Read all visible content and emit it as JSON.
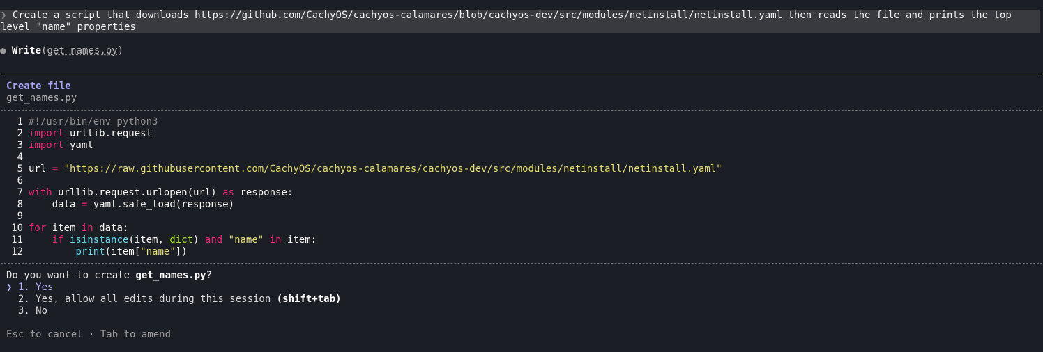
{
  "prompt": {
    "chevron": "❯",
    "text": "Create a script that downloads https://github.com/CachyOS/cachyos-calamares/blob/cachyos-dev/src/modules/netinstall/netinstall.yaml then reads the file and prints the top level \"name\" properties"
  },
  "tool_call": {
    "bullet": "●",
    "name": "Write",
    "open_paren": "(",
    "path": "get_names.py",
    "close_paren": ")"
  },
  "create_panel": {
    "title": "Create file",
    "filename": "get_names.py"
  },
  "code": {
    "line_numbers": [
      "1",
      "2",
      "3",
      "4",
      "5",
      "6",
      "7",
      "8",
      "9",
      "10",
      "11",
      "12"
    ],
    "l1": {
      "comment": "#!/usr/bin/env python3"
    },
    "l2": {
      "kw": "import",
      "rest": " urllib.request"
    },
    "l3": {
      "kw": "import",
      "rest": " yaml"
    },
    "l5": {
      "pre": "url ",
      "op": "=",
      "sp": " ",
      "str": "\"https://raw.githubusercontent.com/CachyOS/cachyos-calamares/cachyos-dev/src/modules/netinstall/netinstall.yaml\""
    },
    "l7": {
      "kw": "with",
      "mid": " urllib.request.urlopen(url) ",
      "kw2": "as",
      "rest": " response:"
    },
    "l8": {
      "indent": "    ",
      "pre": "data ",
      "op": "=",
      "rest": " yaml.safe_load(response)"
    },
    "l10": {
      "kw": "for",
      "mid": " item ",
      "kw2": "in",
      "rest": " data:"
    },
    "l11": {
      "indent": "    ",
      "kw": "if",
      "sp": " ",
      "builtin": "isinstance",
      "mid": "(item, ",
      "type": "dict",
      "mid2": ") ",
      "kw2": "and",
      "sp2": " ",
      "str": "\"name\"",
      "sp3": " ",
      "kw3": "in",
      "rest": " item:"
    },
    "l12": {
      "indent": "        ",
      "builtin": "print",
      "mid": "(item[",
      "str": "\"name\"",
      "rest": "])"
    }
  },
  "confirm": {
    "question_pre": "Do you want to create ",
    "question_file": "get_names.py",
    "question_post": "?",
    "options": [
      {
        "marker": "❯ ",
        "label": "1. Yes",
        "hint": ""
      },
      {
        "marker": "  ",
        "label": "2. Yes, allow all edits during this session ",
        "hint": "(shift+tab)"
      },
      {
        "marker": "  ",
        "label": "3. No",
        "hint": ""
      }
    ],
    "footer": "Esc to cancel · Tab to amend"
  },
  "colors": {
    "background": "#1c1e26",
    "prompt_bg": "#393a3f",
    "accent": "#a7a7f2",
    "keyword": "#f0266f",
    "string": "#e6db74",
    "builtin": "#66d9ef",
    "type": "#a6e22e"
  }
}
